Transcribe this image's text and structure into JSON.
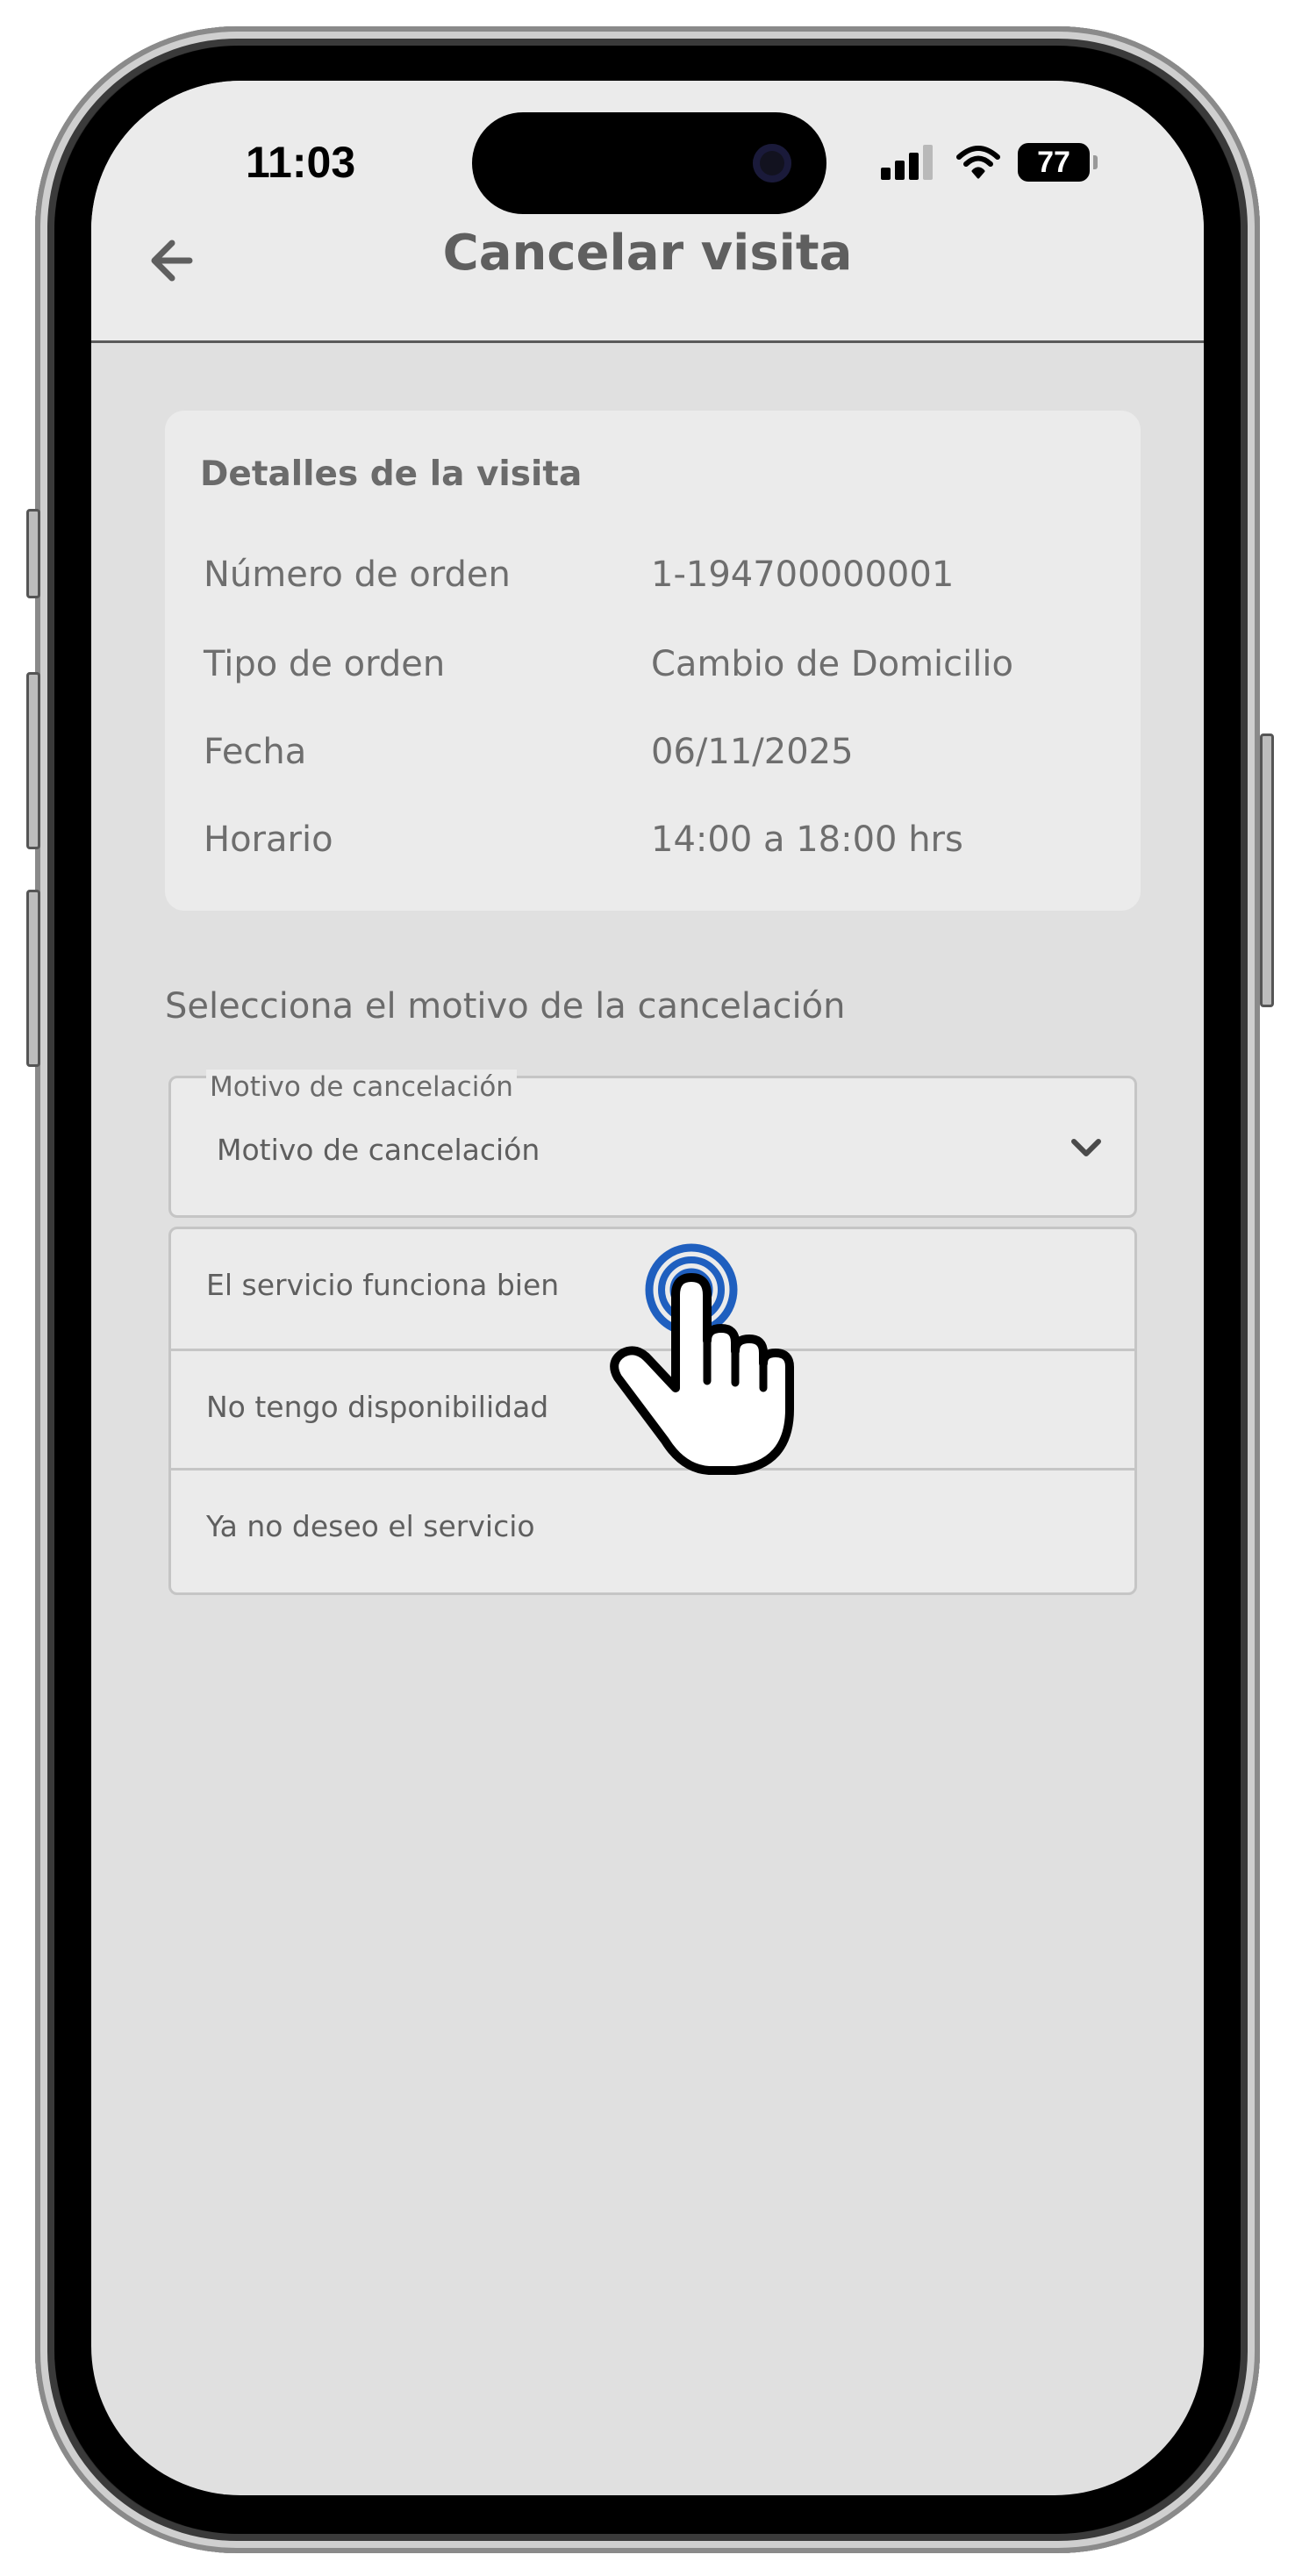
{
  "status_bar": {
    "time": "11:03",
    "battery": "77",
    "icons": [
      "cellular-signal-icon",
      "wifi-icon",
      "battery-icon"
    ]
  },
  "header": {
    "title": "Cancelar visita",
    "back_icon": "arrow-left-icon"
  },
  "details": {
    "title": "Detalles de la visita",
    "rows": [
      {
        "label": "Número de orden",
        "value": "1-194700000001"
      },
      {
        "label": "Tipo de orden",
        "value": "Cambio de Domicilio"
      },
      {
        "label": "Fecha",
        "value": "06/11/2025"
      },
      {
        "label": "Horario",
        "value": "14:00 a 18:00 hrs"
      }
    ]
  },
  "cancel_reason": {
    "section_label": "Selecciona el motivo de la cancelación",
    "select": {
      "floating_label": "Motivo de cancelación",
      "value": "Motivo de cancelación",
      "icon": "chevron-down-icon"
    },
    "options": [
      "El servicio funciona bien",
      "No tengo disponibilidad",
      "Ya no deseo el servicio"
    ]
  },
  "colors": {
    "screen_bg": "#e0e0e0",
    "card_bg": "#ebebeb",
    "text": "#6b6b6b",
    "tap_accent": "#1f5fbf"
  }
}
